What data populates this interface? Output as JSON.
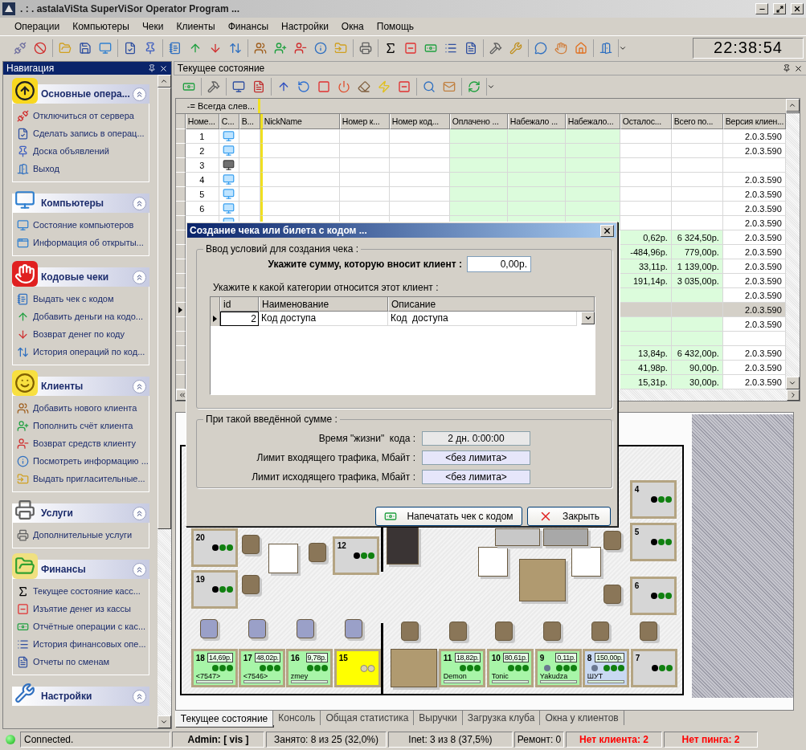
{
  "window": {
    "title": ". : .  astalaViSta SuperViSor Operator Program ..."
  },
  "menu": [
    "Операции",
    "Компьютеры",
    "Чеки",
    "Клиенты",
    "Финансы",
    "Настройки",
    "Окна",
    "Помощь"
  ],
  "clock": "22:38:54",
  "navigation": {
    "title": "Навигация",
    "groups": [
      {
        "title": "Основные опера...",
        "items": [
          "Отключиться от сервера",
          "Сделать запись в операц...",
          "Доска объявлений",
          "Выход"
        ]
      },
      {
        "title": "Компьютеры",
        "items": [
          "Состояние компьютеров",
          "Информация об открыты..."
        ]
      },
      {
        "title": "Кодовые чеки",
        "items": [
          "Выдать чек с кодом",
          "Добавить деньги на кодо...",
          "Возврат денег по коду",
          "История операций по код..."
        ]
      },
      {
        "title": "Клиенты",
        "items": [
          "Добавить нового клиента",
          "Пополнить счёт клиента",
          "Возврат средств клиенту",
          "Посмотреть информацию ...",
          "Выдать пригласительные..."
        ]
      },
      {
        "title": "Услуги",
        "items": [
          "Дополнительные услуги"
        ]
      },
      {
        "title": "Финансы",
        "items": [
          "Текущее состояние касс...",
          "Изъятие денег из кассы",
          "Отчётные операции с кас...",
          "История финансовых опе...",
          "Отчеты по сменам"
        ]
      },
      {
        "title": "Настройки"
      }
    ]
  },
  "panel": {
    "title": "Текущее состояние"
  },
  "grid": {
    "group_banner": "-= Всегда слев...",
    "columns": [
      "Номе...",
      "С...",
      "В...",
      "NickName",
      "Номер к...",
      "Номер код...",
      "Оплачено ...",
      "Набежало ...",
      "Набежало...",
      "Осталос...",
      "Всего по...",
      "Версия клиен..."
    ],
    "rows": [
      {
        "number": "1",
        "monitor_on": true,
        "highlighted": false,
        "selected": false,
        "version": "2.0.3.590"
      },
      {
        "number": "2",
        "monitor_on": true,
        "highlighted": false,
        "selected": false,
        "version": "2.0.3.590"
      },
      {
        "number": "3",
        "monitor_on": false,
        "highlighted": false,
        "selected": false
      },
      {
        "number": "4",
        "monitor_on": true,
        "highlighted": false,
        "selected": false,
        "version": "2.0.3.590"
      },
      {
        "number": "5",
        "monitor_on": true,
        "highlighted": false,
        "selected": false,
        "version": "2.0.3.590"
      },
      {
        "number": "6",
        "monitor_on": true,
        "highlighted": false,
        "selected": false,
        "version": "2.0.3.590"
      },
      {
        "monitor_on": true,
        "highlighted": false,
        "selected": false,
        "version": "2.0.3.590"
      },
      {
        "highlighted": true,
        "selected": false,
        "remaining": "0,62р.",
        "total": "6 324,50р.",
        "version": "2.0.3.590"
      },
      {
        "highlighted": true,
        "selected": false,
        "remaining": "-484,96р.",
        "total": "779,00р.",
        "version": "2.0.3.590"
      },
      {
        "highlighted": true,
        "selected": false,
        "remaining": "33,11р.",
        "total": "1 139,00р.",
        "version": "2.0.3.590"
      },
      {
        "highlighted": true,
        "selected": false,
        "remaining": "191,14р.",
        "total": "3 035,00р.",
        "version": "2.0.3.590"
      },
      {
        "highlighted": true,
        "selected": false,
        "version": "2.0.3.590"
      },
      {
        "selected": true,
        "version": "2.0.3.590"
      },
      {
        "highlighted": true,
        "selected": false,
        "version": "2.0.3.590"
      },
      {
        "highlighted": true,
        "selected": false
      },
      {
        "highlighted": true,
        "selected": false,
        "remaining": "13,84р.",
        "total": "6 432,00р.",
        "version": "2.0.3.590"
      },
      {
        "highlighted": true,
        "selected": false,
        "remaining": "41,98р.",
        "total": "90,00р.",
        "version": "2.0.3.590"
      },
      {
        "highlighted": true,
        "selected": false,
        "remaining": "15,31р.",
        "total": "30,00р.",
        "version": "2.0.3.590"
      }
    ]
  },
  "floor": {
    "computers": [
      {
        "number": "20",
        "kind": "station",
        "color": "#d6d6d6",
        "occupied": false,
        "extra_dot": false
      },
      {
        "number": "19",
        "kind": "station",
        "color": "#d6d6d6",
        "occupied": false,
        "extra_dot": false
      },
      {
        "number": "12",
        "kind": "station",
        "color": "#d6d6d6",
        "occupied": false,
        "extra_dot": false
      },
      {
        "number": "4",
        "kind": "station",
        "color": "#d6d6d6",
        "occupied": false,
        "extra_dot": false
      },
      {
        "number": "5",
        "kind": "station",
        "color": "#d6d6d6",
        "occupied": false,
        "extra_dot": false
      },
      {
        "number": "6",
        "kind": "station",
        "color": "#d6d6d6",
        "occupied": false,
        "extra_dot": false
      },
      {
        "number": "18",
        "kind": "station",
        "color": "#a8f5a8",
        "occupied": true,
        "extra_dot": false,
        "balance": "14,69р.",
        "user": "<7547>"
      },
      {
        "number": "17",
        "kind": "station",
        "color": "#a8f5a8",
        "occupied": true,
        "extra_dot": false,
        "balance": "48,02р.",
        "user": "<7546>"
      },
      {
        "number": "16",
        "kind": "station",
        "color": "#a8f5a8",
        "occupied": true,
        "extra_dot": false,
        "balance": "9,78р.",
        "user": "zmey"
      },
      {
        "number": "15",
        "kind": "locked",
        "color": "#ffff00"
      },
      {
        "number": "11",
        "kind": "station",
        "color": "#a8f5a8",
        "occupied": true,
        "extra_dot": false,
        "balance": "18,82р.",
        "user": "Demon"
      },
      {
        "number": "10",
        "kind": "station",
        "color": "#a8f5a8",
        "occupied": true,
        "extra_dot": false,
        "balance": "80,61р.",
        "user": "Tonic"
      },
      {
        "number": "9",
        "kind": "station",
        "color": "#a8f5a8",
        "occupied": true,
        "extra_dot": true,
        "balance": "0,11р.",
        "user": "Yakudza"
      },
      {
        "number": "8",
        "kind": "station",
        "color": "#c9d9f2",
        "occupied": true,
        "extra_dot": true,
        "balance": "150,00р.",
        "user": "ШУТ"
      },
      {
        "number": "7",
        "kind": "station",
        "color": "#d6d6d6",
        "occupied": false,
        "extra_dot": false
      }
    ]
  },
  "bottom_tabs": [
    {
      "label": "Текущее состояние",
      "selected": true
    },
    {
      "label": "Консоль",
      "selected": false
    },
    {
      "label": "Общая статистика",
      "selected": false
    },
    {
      "label": "Выручки",
      "selected": false
    },
    {
      "label": "Загрузка клуба",
      "selected": false
    },
    {
      "label": "Окна у клиентов",
      "selected": false
    }
  ],
  "status_bar": [
    {
      "text": "Connected.",
      "kind": "connection"
    },
    {
      "text": "Admin: [ vis ]",
      "kind": "user"
    },
    {
      "text": "Занято: 8 из 25 (32,0%)",
      "kind": "plain"
    },
    {
      "text": "Inet: 3 из 8 (37,5%)",
      "kind": "plain"
    },
    {
      "text": "Ремонт: 0",
      "kind": "plain"
    },
    {
      "text": "Нет клиента: 2",
      "kind": "alert"
    },
    {
      "text": "Нет пинга: 2",
      "kind": "alert"
    }
  ],
  "dialog": {
    "title": "Создание чека или билета с кодом ...",
    "input_group": {
      "legend": "Ввод условий для создания чека :",
      "amount_label": "Укажите сумму, которую вносит клиент :",
      "amount_value": "0,00р.",
      "category_label": "Укажите к какой категории относится этот клиент :",
      "columns": [
        "id",
        "Наименование",
        "Описание"
      ],
      "rows": [
        {
          "id": "2",
          "name": "Код доступа",
          "description": "Код  доступа",
          "selected": true
        }
      ]
    },
    "result_group": {
      "legend": "При такой введённой сумме :",
      "fields": [
        {
          "label": "Время \"жизни\"  кода :",
          "value": "2 дн. 0:00:00",
          "kind": "time"
        },
        {
          "label": "Лимит входящего трафика, Мбайт :",
          "value": "<без лимита>",
          "kind": "limit"
        },
        {
          "label": "Лимит исходящего трафика, Мбайт :",
          "value": "<без лимита>",
          "kind": "limit"
        }
      ]
    },
    "buttons": [
      {
        "label": "Напечатать чек с кодом",
        "kind": "print"
      },
      {
        "label": "Закрыть",
        "kind": "close"
      }
    ]
  }
}
